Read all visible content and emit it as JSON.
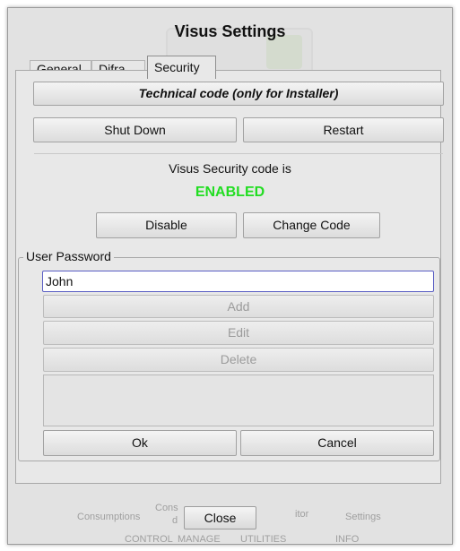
{
  "window": {
    "title": "Visus Settings"
  },
  "tabs": [
    {
      "label": "General"
    },
    {
      "label": "Difra"
    },
    {
      "label": "Security"
    }
  ],
  "security": {
    "technical_code_label": "Technical code (only for Installer)",
    "shut_down_label": "Shut Down",
    "restart_label": "Restart",
    "code_status_text": "Visus Security code is",
    "code_status_value": "ENABLED",
    "status_color": "#22dd22",
    "disable_label": "Disable",
    "change_code_label": "Change Code"
  },
  "user_password": {
    "group_label": "User Password",
    "input_value": "John",
    "add_label": "Add",
    "edit_label": "Edit",
    "delete_label": "Delete",
    "ok_label": "Ok",
    "cancel_label": "Cancel"
  },
  "background_bar": {
    "consumptions": "Consumptions",
    "cons_partial": "Cons",
    "cons_partial2": "d",
    "monitor_partial": "itor",
    "settings": "Settings",
    "control": "CONTROL",
    "manage": "MANAGE",
    "utilities": "UTILITIES",
    "info": "INFO"
  },
  "close_label": "Close"
}
